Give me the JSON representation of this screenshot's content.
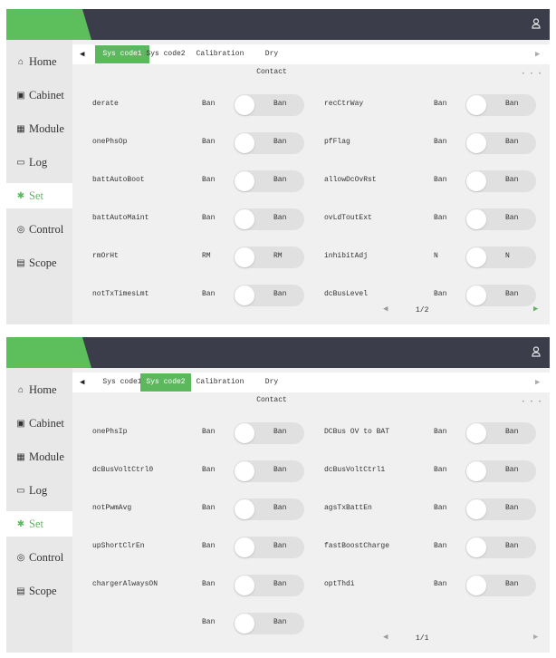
{
  "user_icon": "user-icon",
  "nav": [
    {
      "icon": "home-icon",
      "glyph": "⌂",
      "label": "Home"
    },
    {
      "icon": "cabinet-icon",
      "glyph": "▣",
      "label": "Cabinet"
    },
    {
      "icon": "module-icon",
      "glyph": "▦",
      "label": "Module"
    },
    {
      "icon": "log-icon",
      "glyph": "▭",
      "label": "Log"
    },
    {
      "icon": "set-icon",
      "glyph": "✱",
      "label": "Set"
    },
    {
      "icon": "control-icon",
      "glyph": "◎",
      "label": "Control"
    },
    {
      "icon": "scope-icon",
      "glyph": "▤",
      "label": "Scope"
    }
  ],
  "colors": {
    "accent": "#5cb85c",
    "topbar": "#3b3d4a",
    "panel": "#f0f0f0",
    "sidebar": "#e8e8e8"
  },
  "panels": [
    {
      "active_nav": "Set",
      "tabs": [
        "Sys code1",
        "Sys code2",
        "Calibration",
        "Dry Contact"
      ],
      "active_tab": "Sys code1",
      "rows": [
        [
          {
            "label": "derate",
            "value": "Ban",
            "toggle": "Ban"
          },
          {
            "label": "recCtrWay",
            "value": "Ban",
            "toggle": "Ban"
          }
        ],
        [
          {
            "label": "onePhsOp",
            "value": "Ban",
            "toggle": "Ban"
          },
          {
            "label": "pfFlag",
            "value": "Ban",
            "toggle": "Ban"
          }
        ],
        [
          {
            "label": "battAutoBoot",
            "value": "Ban",
            "toggle": "Ban"
          },
          {
            "label": "allowDcOvRst",
            "value": "Ban",
            "toggle": "Ban"
          }
        ],
        [
          {
            "label": "battAutoMaint",
            "value": "Ban",
            "toggle": "Ban"
          },
          {
            "label": "ovLdToutExt",
            "value": "Ban",
            "toggle": "Ban"
          }
        ],
        [
          {
            "label": "rmOrHt",
            "value": "RM",
            "toggle": "RM"
          },
          {
            "label": "inhibitAdj",
            "value": "N",
            "toggle": "N"
          }
        ],
        [
          {
            "label": "notTxTimesLmt",
            "value": "Ban",
            "toggle": "Ban"
          },
          {
            "label": "dcBusLevel",
            "value": "Ban",
            "toggle": "Ban"
          }
        ]
      ],
      "page": "1/2",
      "next_enabled": true
    },
    {
      "active_nav": "Set",
      "tabs": [
        "Sys code1",
        "Sys code2",
        "Calibration",
        "Dry Contact"
      ],
      "active_tab": "Sys code2",
      "rows": [
        [
          {
            "label": "onePhsIp",
            "value": "Ban",
            "toggle": "Ban"
          },
          {
            "label": "DCBus OV to BAT",
            "value": "Ban",
            "toggle": "Ban"
          }
        ],
        [
          {
            "label": "dcBusVoltCtrl0",
            "value": "Ban",
            "toggle": "Ban"
          },
          {
            "label": "dcBusVoltCtrl1",
            "value": "Ban",
            "toggle": "Ban"
          }
        ],
        [
          {
            "label": "notPwmAvg",
            "value": "Ban",
            "toggle": "Ban"
          },
          {
            "label": "agsTxBattEn",
            "value": "Ban",
            "toggle": "Ban"
          }
        ],
        [
          {
            "label": "upShortClrEn",
            "value": "Ban",
            "toggle": "Ban"
          },
          {
            "label": "fastBoostCharge",
            "value": "Ban",
            "toggle": "Ban"
          }
        ],
        [
          {
            "label": "chargerAlwaysON",
            "value": "Ban",
            "toggle": "Ban"
          },
          {
            "label": "optThdi",
            "value": "Ban",
            "toggle": "Ban"
          }
        ],
        [
          {
            "label": "",
            "value": "Ban",
            "toggle": "Ban"
          }
        ]
      ],
      "page": "1/1",
      "next_enabled": false
    }
  ]
}
